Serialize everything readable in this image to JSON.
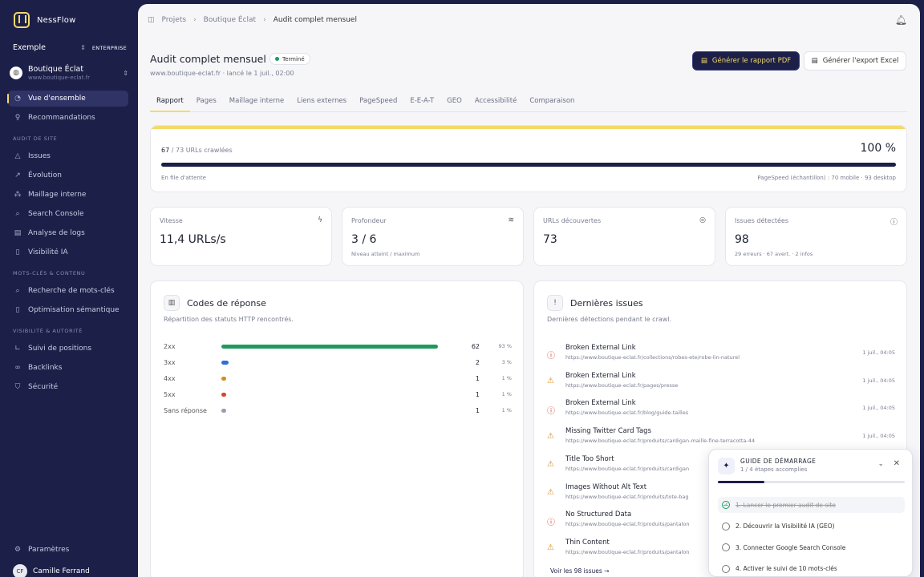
{
  "app": {
    "name": "NessFlow"
  },
  "workspace": {
    "name": "Exemple",
    "plan": "ENTERPRISE"
  },
  "project": {
    "name": "Boutique Éclat",
    "domain": "www.boutique-eclat.fr"
  },
  "sidebar": {
    "top": [
      {
        "label": "Vue d'ensemble",
        "icon": "gauge-icon",
        "active": true
      },
      {
        "label": "Recommandations",
        "icon": "lightbulb-icon"
      }
    ],
    "sections": [
      {
        "title": "AUDIT DE SITE",
        "items": [
          {
            "label": "Issues",
            "icon": "warning-icon"
          },
          {
            "label": "Évolution",
            "icon": "trend-icon"
          },
          {
            "label": "Maillage interne",
            "icon": "network-icon"
          },
          {
            "label": "Search Console",
            "icon": "search-icon"
          },
          {
            "label": "Analyse de logs",
            "icon": "logs-icon"
          },
          {
            "label": "Visibilité IA",
            "icon": "document-icon"
          }
        ]
      },
      {
        "title": "MOTS-CLÉS & CONTENU",
        "items": [
          {
            "label": "Recherche de mots-clés",
            "icon": "search-icon"
          },
          {
            "label": "Optimisation sémantique",
            "icon": "document-icon"
          }
        ]
      },
      {
        "title": "VISIBILITÉ & AUTORITÉ",
        "items": [
          {
            "label": "Suivi de positions",
            "icon": "chart-icon"
          },
          {
            "label": "Backlinks",
            "icon": "link-icon"
          },
          {
            "label": "Sécurité",
            "icon": "shield-icon"
          }
        ]
      }
    ],
    "settings": "Paramètres",
    "user": {
      "initials": "CF",
      "name": "Camille Ferrand"
    }
  },
  "breadcrumb": [
    "Projets",
    "Boutique Éclat",
    "Audit complet mensuel"
  ],
  "header": {
    "title": "Audit complet mensuel",
    "status": "Terminé",
    "subtitle": "www.boutique-eclat.fr · lancé le 1 juil., 02:00",
    "pdf_button": "Générer le rapport PDF",
    "excel_button": "Générer l'export Excel"
  },
  "tabs": [
    "Rapport",
    "Pages",
    "Maillage interne",
    "Liens externes",
    "PageSpeed",
    "E-E-A-T",
    "GEO",
    "Accessibilité",
    "Comparaison"
  ],
  "active_tab": "Rapport",
  "progress": {
    "crawled": "67",
    "total_text": "/ 73 URLs crawlées",
    "percent_text": "100 %",
    "fraction": 1.0,
    "queue": "En file d'attente",
    "pagespeed": "PageSpeed (échantillon) : 70 mobile · 93 desktop"
  },
  "stats": [
    {
      "label": "Vitesse",
      "value": "11,4 URLs/s",
      "sub": "",
      "icon": "bolt-icon"
    },
    {
      "label": "Profondeur",
      "value": "3 / 6",
      "sub": "Niveau atteint / maximum",
      "icon": "layers-icon"
    },
    {
      "label": "URLs découvertes",
      "value": "73",
      "sub": "",
      "icon": "radar-icon"
    },
    {
      "label": "Issues détectées",
      "value": "98",
      "sub": "29 erreurs · 67 avert. · 2 infos",
      "icon": "info-icon"
    }
  ],
  "codes": {
    "title": "Codes de réponse",
    "desc": "Répartition des statuts HTTP rencontrés.",
    "rows": [
      {
        "label": "2xx",
        "count": "62",
        "pct": "93 %",
        "share": 0.93,
        "color": "#1f9a5c"
      },
      {
        "label": "3xx",
        "count": "2",
        "pct": "3 %",
        "share": 0.03,
        "color": "#2f6fd6"
      },
      {
        "label": "4xx",
        "count": "1",
        "pct": "1 %",
        "share": 0.015,
        "color": "#d98a1f"
      },
      {
        "label": "5xx",
        "count": "1",
        "pct": "1 %",
        "share": 0.015,
        "color": "#d4452c"
      },
      {
        "label": "Sans réponse",
        "count": "1",
        "pct": "1 %",
        "share": 0.015,
        "color": "#9a9daf"
      }
    ]
  },
  "issues": {
    "title": "Dernières issues",
    "desc": "Dernières détections pendant le crawl.",
    "items": [
      {
        "type": "error",
        "title": "Broken External Link",
        "url": "https://www.boutique-eclat.fr/collections/robes-ete/robe-lin-naturel",
        "date": "1 juil., 04:05"
      },
      {
        "type": "warning",
        "title": "Broken External Link",
        "url": "https://www.boutique-eclat.fr/pages/presse",
        "date": "1 juil., 04:05"
      },
      {
        "type": "error",
        "title": "Broken External Link",
        "url": "https://www.boutique-eclat.fr/blog/guide-tailles",
        "date": "1 juil., 04:05"
      },
      {
        "type": "warning",
        "title": "Missing Twitter Card Tags",
        "url": "https://www.boutique-eclat.fr/produits/cardigan-maille-fine-terracotta-44",
        "date": "1 juil., 04:05"
      },
      {
        "type": "warning",
        "title": "Title Too Short",
        "url": "https://www.boutique-eclat.fr/produits/cardigan",
        "date": ""
      },
      {
        "type": "warning",
        "title": "Images Without Alt Text",
        "url": "https://www.boutique-eclat.fr/produits/tote-bag",
        "date": ""
      },
      {
        "type": "error",
        "title": "No Structured Data",
        "url": "https://www.boutique-eclat.fr/produits/pantalon",
        "date": ""
      },
      {
        "type": "warning",
        "title": "Thin Content",
        "url": "https://www.boutique-eclat.fr/produits/pantalon",
        "date": ""
      }
    ],
    "more": "Voir les 98 issues →"
  },
  "guide": {
    "title": "GUIDE DE DÉMARRAGE",
    "subtitle": "1 / 4 étapes accomplies",
    "fraction": 0.25,
    "steps": [
      {
        "label": "1. Lancer le premier audit de site",
        "done": true
      },
      {
        "label": "2. Découvrir la Visibilité IA (GEO)",
        "done": false
      },
      {
        "label": "3. Connecter Google Search Console",
        "done": false
      },
      {
        "label": "4. Activer le suivi de 10 mots-clés",
        "done": false
      }
    ]
  }
}
